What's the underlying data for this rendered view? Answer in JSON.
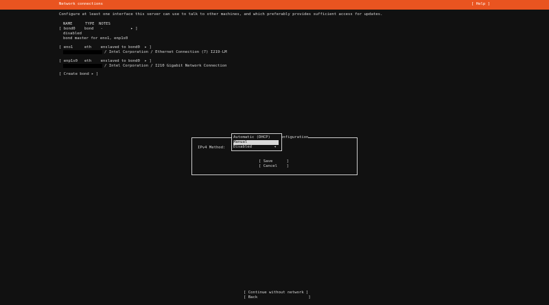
{
  "header": {
    "title": "Network connections",
    "help": "[ Help ]"
  },
  "intro": "Configure at least one interface this server can use to talk to other machines, and which preferably provides sufficient access for updates.",
  "table": {
    "headers": {
      "name": "NAME",
      "type": "TYPE",
      "notes": "NOTES"
    },
    "bond0": {
      "row": "[ bond0    bond   -            ▸ ]",
      "state": "disabled",
      "note": "bond master for eno1, enp1s0"
    },
    "eno1": {
      "row": "[ eno1     eth    enslaved to bond0  ▸ ]",
      "desc": "/ Intel Corporation / Ethernet Connection (7) I219-LM"
    },
    "enp1s0": {
      "row": "[ enp1s0   eth    enslaved to bond0  ▸ ]",
      "desc": "/ Intel Corporation / I210 Gigabit Network Connection"
    }
  },
  "create_bond": "[ Create bond ▸ ]",
  "dialog": {
    "title_fragment": "onfiguration",
    "ipv4_label": "IPv4 Method:",
    "save": "[ Save      ]",
    "cancel": "[ Cancel    ]"
  },
  "dropdown": {
    "options": [
      {
        "label": "Automatic (DHCP)"
      },
      {
        "label": "Manual"
      },
      {
        "label": "Disabled"
      }
    ],
    "selected": "Manual",
    "arrow": "◂"
  },
  "footer": {
    "continue": "[ Continue without network ]",
    "back": "[ Back                      ]"
  }
}
